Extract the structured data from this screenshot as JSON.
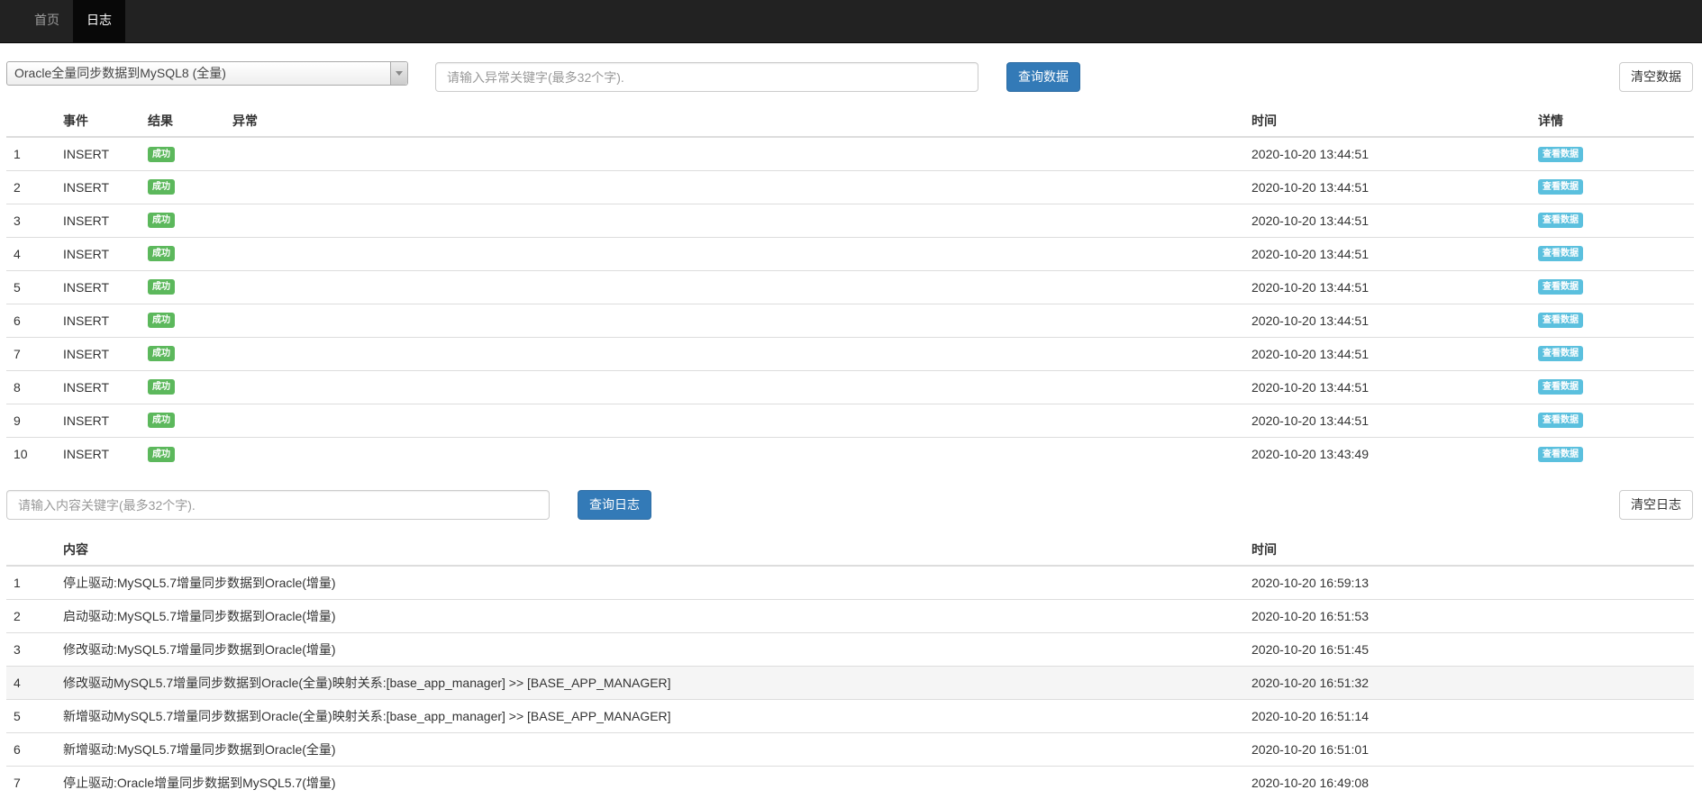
{
  "navbar": {
    "items": [
      {
        "label": "首页",
        "active": false
      },
      {
        "label": "日志",
        "active": true
      }
    ]
  },
  "data_panel": {
    "driver_select": {
      "selected": "Oracle全量同步数据到MySQL8 (全量)"
    },
    "search": {
      "placeholder": "请输入异常关键字(最多32个字)."
    },
    "query_button": "查询数据",
    "clear_button": "清空数据",
    "columns": [
      "",
      "事件",
      "结果",
      "异常",
      "时间",
      "详情"
    ],
    "rows": [
      {
        "no": "1",
        "event": "INSERT",
        "result": "成功",
        "error": "",
        "time": "2020-10-20 13:44:51",
        "detail": "查看数据"
      },
      {
        "no": "2",
        "event": "INSERT",
        "result": "成功",
        "error": "",
        "time": "2020-10-20 13:44:51",
        "detail": "查看数据"
      },
      {
        "no": "3",
        "event": "INSERT",
        "result": "成功",
        "error": "",
        "time": "2020-10-20 13:44:51",
        "detail": "查看数据"
      },
      {
        "no": "4",
        "event": "INSERT",
        "result": "成功",
        "error": "",
        "time": "2020-10-20 13:44:51",
        "detail": "查看数据"
      },
      {
        "no": "5",
        "event": "INSERT",
        "result": "成功",
        "error": "",
        "time": "2020-10-20 13:44:51",
        "detail": "查看数据"
      },
      {
        "no": "6",
        "event": "INSERT",
        "result": "成功",
        "error": "",
        "time": "2020-10-20 13:44:51",
        "detail": "查看数据"
      },
      {
        "no": "7",
        "event": "INSERT",
        "result": "成功",
        "error": "",
        "time": "2020-10-20 13:44:51",
        "detail": "查看数据"
      },
      {
        "no": "8",
        "event": "INSERT",
        "result": "成功",
        "error": "",
        "time": "2020-10-20 13:44:51",
        "detail": "查看数据"
      },
      {
        "no": "9",
        "event": "INSERT",
        "result": "成功",
        "error": "",
        "time": "2020-10-20 13:44:51",
        "detail": "查看数据"
      },
      {
        "no": "10",
        "event": "INSERT",
        "result": "成功",
        "error": "",
        "time": "2020-10-20 13:43:49",
        "detail": "查看数据"
      }
    ]
  },
  "log_panel": {
    "search": {
      "placeholder": "请输入内容关键字(最多32个字)."
    },
    "query_button": "查询日志",
    "clear_button": "清空日志",
    "columns": [
      "",
      "内容",
      "时间"
    ],
    "rows": [
      {
        "no": "1",
        "content": "停止驱动:MySQL5.7增量同步数据到Oracle(增量)",
        "time": "2020-10-20 16:59:13"
      },
      {
        "no": "2",
        "content": "启动驱动:MySQL5.7增量同步数据到Oracle(增量)",
        "time": "2020-10-20 16:51:53"
      },
      {
        "no": "3",
        "content": "修改驱动:MySQL5.7增量同步数据到Oracle(增量)",
        "time": "2020-10-20 16:51:45"
      },
      {
        "no": "4",
        "content": "修改驱动MySQL5.7增量同步数据到Oracle(全量)映射关系:[base_app_manager] >> [BASE_APP_MANAGER]",
        "time": "2020-10-20 16:51:32"
      },
      {
        "no": "5",
        "content": "新增驱动MySQL5.7增量同步数据到Oracle(全量)映射关系:[base_app_manager] >> [BASE_APP_MANAGER]",
        "time": "2020-10-20 16:51:14"
      },
      {
        "no": "6",
        "content": "新增驱动:MySQL5.7增量同步数据到Oracle(全量)",
        "time": "2020-10-20 16:51:01"
      },
      {
        "no": "7",
        "content": "停止驱动:Oracle增量同步数据到MySQL5.7(增量)",
        "time": "2020-10-20 16:49:08"
      }
    ]
  },
  "colors": {
    "navbar": "#222222",
    "primary": "#337ab7",
    "success": "#5cb85c",
    "info": "#5bc0de"
  }
}
